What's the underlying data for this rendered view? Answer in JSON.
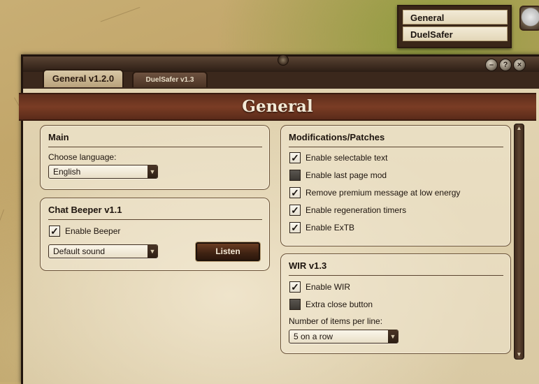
{
  "mini_menu": {
    "items": [
      {
        "label": "General"
      },
      {
        "label": "DuelSafer"
      }
    ]
  },
  "window": {
    "tabs": [
      {
        "label": "General v1.2.0"
      },
      {
        "label": "DuelSafer v1.3"
      }
    ],
    "buttons": {
      "minimize": "–",
      "help": "?",
      "close": "×"
    },
    "header_title": "General"
  },
  "main_panel": {
    "title": "Main",
    "language_label": "Choose language:",
    "language_value": "English"
  },
  "beeper_panel": {
    "title": "Chat Beeper v1.1",
    "enable_label": "Enable Beeper",
    "enable_checked": true,
    "sound_value": "Default sound",
    "listen_label": "Listen"
  },
  "mods_panel": {
    "title": "Modifications/Patches",
    "options": [
      {
        "label": "Enable selectable text",
        "checked": true
      },
      {
        "label": "Enable last page mod",
        "checked": false
      },
      {
        "label": "Remove premium message at low energy",
        "checked": true
      },
      {
        "label": "Enable regeneration timers",
        "checked": true
      },
      {
        "label": "Enable ExTB",
        "checked": true
      }
    ]
  },
  "wir_panel": {
    "title": "WIR v1.3",
    "options": [
      {
        "label": "Enable WIR",
        "checked": true
      },
      {
        "label": "Extra close button",
        "checked": false
      }
    ],
    "items_label": "Number of items per line:",
    "items_value": "5 on a row"
  },
  "icons": {
    "check": "✓",
    "dropdown": "▼",
    "scroll_up": "▲",
    "scroll_down": "▼"
  }
}
